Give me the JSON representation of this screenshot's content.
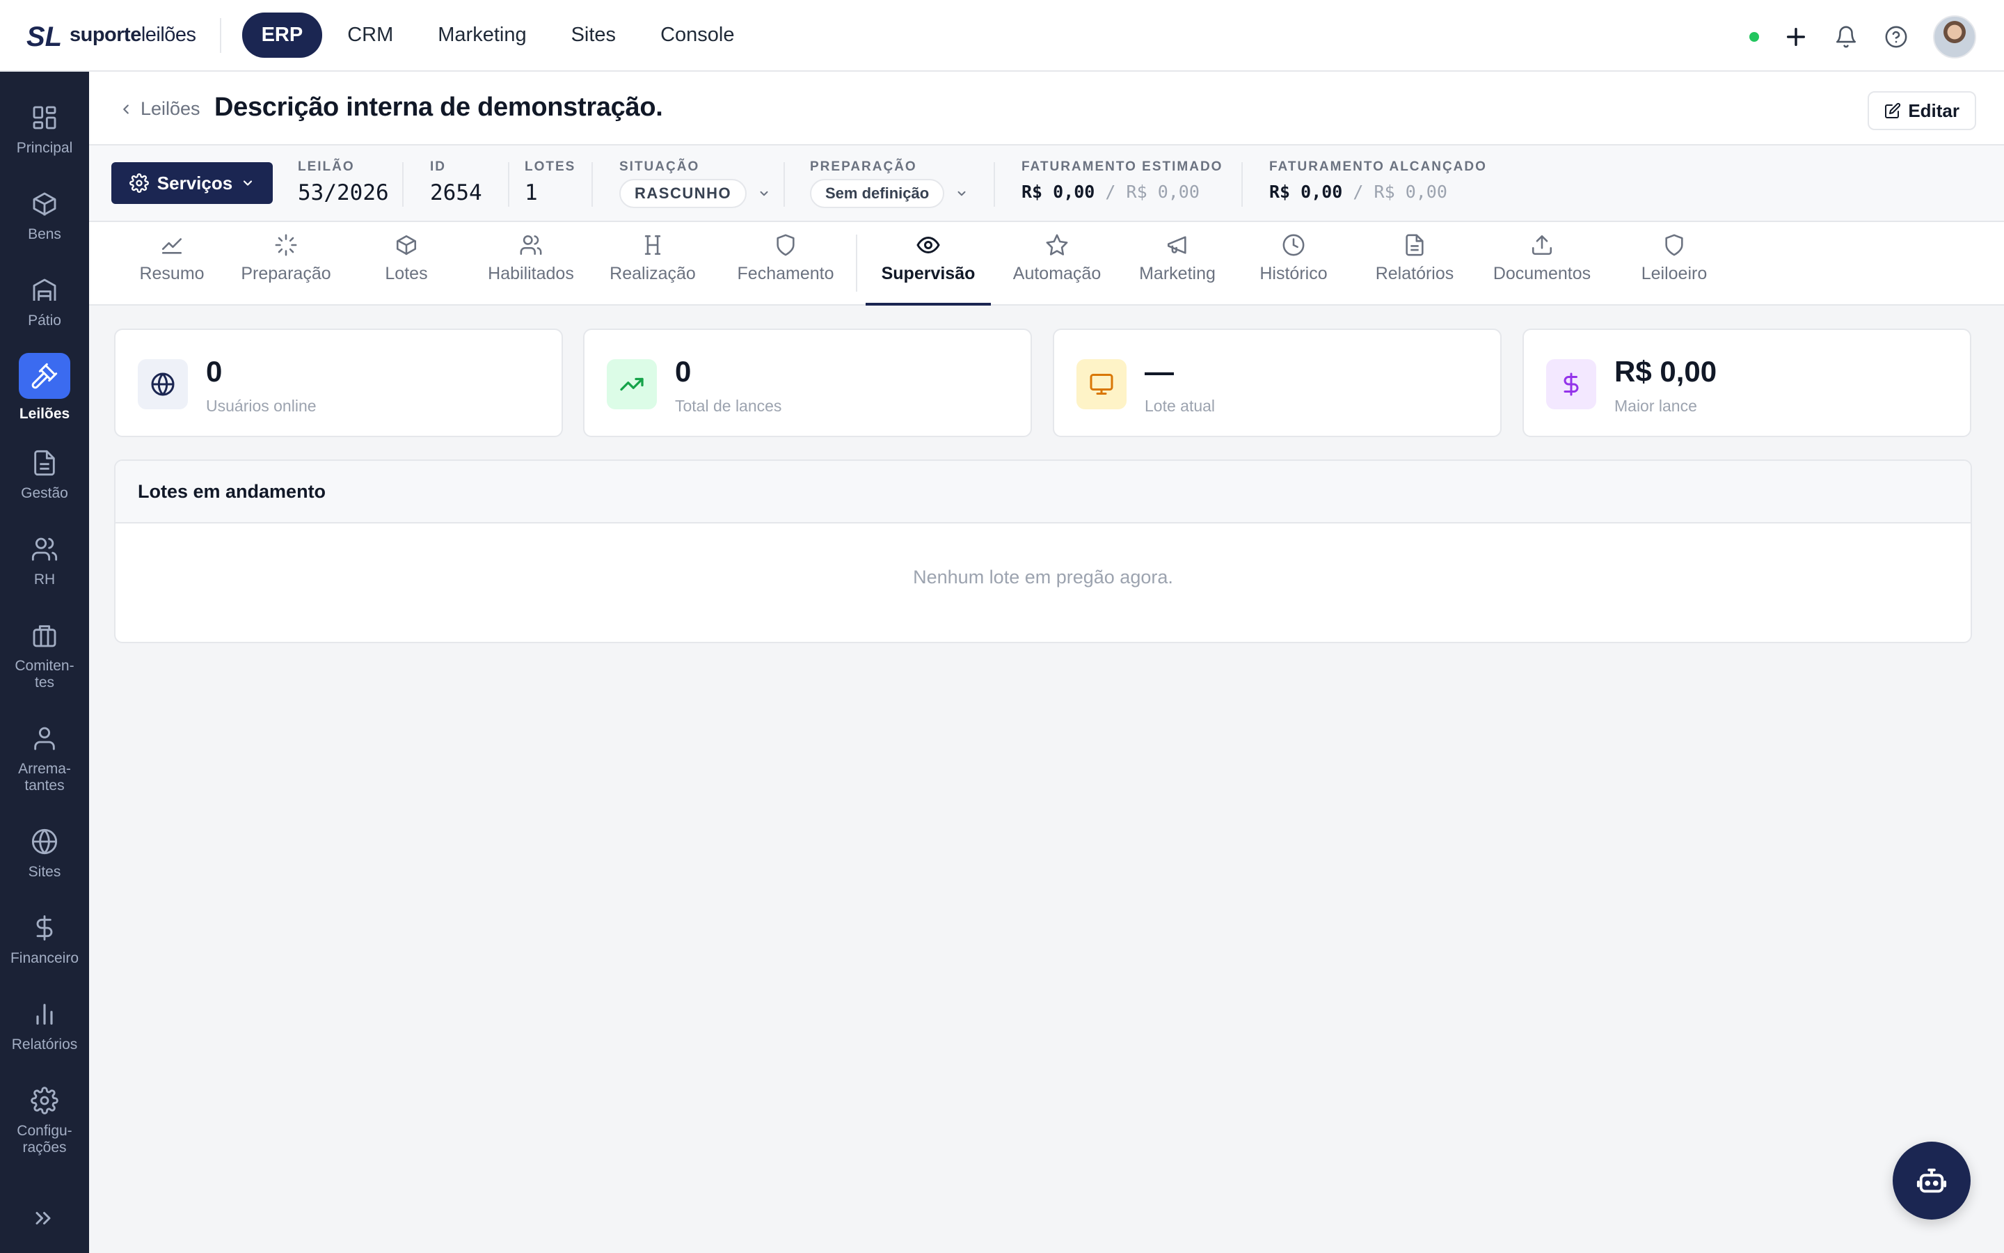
{
  "brand": {
    "name_bold": "suporte",
    "name_light": "leilões"
  },
  "modules": [
    {
      "label": "ERP",
      "active": true
    },
    {
      "label": "CRM"
    },
    {
      "label": "Marketing"
    },
    {
      "label": "Sites"
    },
    {
      "label": "Console"
    }
  ],
  "sidebar": {
    "items": [
      {
        "label": "Principal",
        "icon": "grid-icon"
      },
      {
        "label": "Bens",
        "icon": "box-icon"
      },
      {
        "label": "Pátio",
        "icon": "warehouse-icon"
      },
      {
        "label": "Leilões",
        "icon": "gavel-icon",
        "active": true
      },
      {
        "label": "Gestão",
        "icon": "document-icon"
      },
      {
        "label": "RH",
        "icon": "users-icon"
      },
      {
        "label": "Comiten-\ntes",
        "icon": "briefcase-icon"
      },
      {
        "label": "Arrema-\ntantes",
        "icon": "user-icon"
      },
      {
        "label": "Sites",
        "icon": "globe-icon"
      },
      {
        "label": "Financeiro",
        "icon": "dollar-icon"
      },
      {
        "label": "Relatórios",
        "icon": "bar-chart-icon"
      },
      {
        "label": "Configu-\nrações",
        "icon": "gear-icon"
      }
    ]
  },
  "header": {
    "back_label": "Leilões",
    "title": "Descrição interna de demonstração.",
    "edit_label": "Editar"
  },
  "info": {
    "services_label": "Serviços",
    "leilao_label": "LEILÃO",
    "leilao_value": "53/2026",
    "id_label": "ID",
    "id_value": "2654",
    "lotes_label": "LOTES",
    "lotes_value": "1",
    "situacao_label": "SITUAÇÃO",
    "situacao_value": "RASCUNHO",
    "preparacao_label": "PREPARAÇÃO",
    "preparacao_value": "Sem definição",
    "fat_est_label": "FATURAMENTO ESTIMADO",
    "fat_est_value": "R$ 0,00",
    "fat_est_secondary": "R$ 0,00",
    "fat_alc_label": "FATURAMENTO ALCANÇADO",
    "fat_alc_value": "R$ 0,00",
    "fat_alc_secondary": "R$ 0,00",
    "separator": "/"
  },
  "tabs": [
    {
      "label": "Resumo",
      "icon": "trend-icon"
    },
    {
      "label": "Preparação",
      "icon": "loader-icon"
    },
    {
      "label": "Lotes",
      "icon": "box-icon"
    },
    {
      "label": "Habilitados",
      "icon": "users-icon"
    },
    {
      "label": "Realização",
      "icon": "columns-icon"
    },
    {
      "label": "Fechamento",
      "icon": "shield-icon"
    },
    {
      "label": "Supervisão",
      "icon": "eye-icon",
      "active": true
    },
    {
      "label": "Automação",
      "icon": "star-icon"
    },
    {
      "label": "Marketing",
      "icon": "megaphone-icon"
    },
    {
      "label": "Histórico",
      "icon": "clock-icon"
    },
    {
      "label": "Relatórios",
      "icon": "file-icon"
    },
    {
      "label": "Documentos",
      "icon": "upload-icon"
    },
    {
      "label": "Leiloeiro",
      "icon": "shield-icon"
    }
  ],
  "stats": [
    {
      "value": "0",
      "label": "Usuários online",
      "icon": "globe-icon",
      "color": "#eef1f8"
    },
    {
      "value": "0",
      "label": "Total de lances",
      "icon": "trend-up-icon",
      "color": "#dcfce7"
    },
    {
      "value": "—",
      "label": "Lote atual",
      "icon": "monitor-icon",
      "color": "#fef3c7"
    },
    {
      "value": "R$ 0,00",
      "label": "Maior lance",
      "icon": "dollar-icon",
      "color": "#f3e8ff"
    }
  ],
  "panel": {
    "title": "Lotes em andamento",
    "empty_message": "Nenhum lote em pregão agora."
  },
  "colors": {
    "navy": "#1b2652",
    "sidebar_bg": "#1b2236",
    "accent_blue": "#3b6bf0",
    "online_green": "#22c55e"
  }
}
